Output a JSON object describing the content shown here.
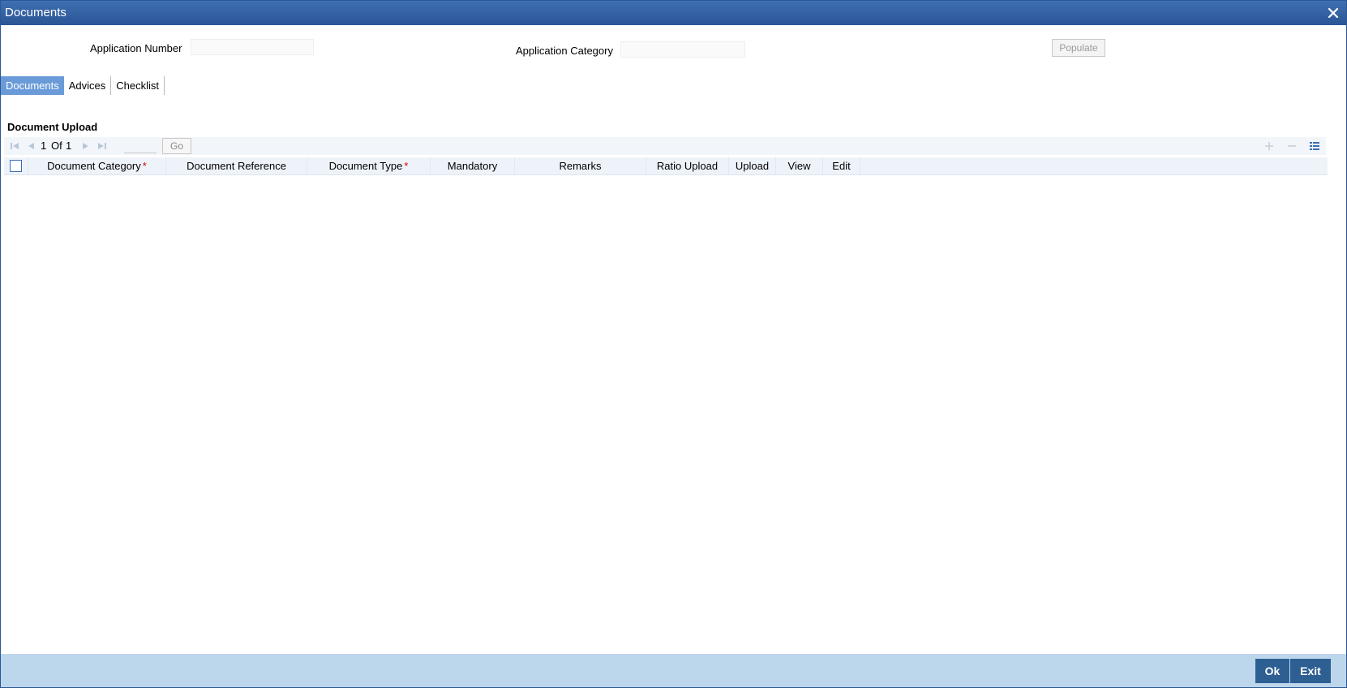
{
  "window": {
    "title": "Documents",
    "close_icon": "close-icon"
  },
  "header_fields": {
    "application_number_label": "Application Number",
    "application_number_value": "",
    "application_category_label": "Application Category",
    "application_category_value": "",
    "populate_label": "Populate"
  },
  "tabs": [
    {
      "label": "Documents",
      "active": true
    },
    {
      "label": "Advices",
      "active": false
    },
    {
      "label": "Checklist",
      "active": false
    }
  ],
  "document_upload": {
    "title": "Document Upload",
    "pagination": {
      "current": "1",
      "of_label": "Of",
      "total": "1",
      "page_input": "",
      "go_label": "Go"
    },
    "columns": [
      {
        "label": "Document Category",
        "required": true
      },
      {
        "label": "Document Reference",
        "required": false
      },
      {
        "label": "Document Type",
        "required": true
      },
      {
        "label": "Mandatory",
        "required": false
      },
      {
        "label": "Remarks",
        "required": false
      },
      {
        "label": "Ratio Upload",
        "required": false
      },
      {
        "label": "Upload",
        "required": false
      },
      {
        "label": "View",
        "required": false
      },
      {
        "label": "Edit",
        "required": false
      }
    ],
    "required_marker": "*",
    "rows": []
  },
  "footer": {
    "ok_label": "Ok",
    "exit_label": "Exit"
  },
  "colors": {
    "title_bar": "#2a5596",
    "active_tab": "#6a9bd8",
    "footer_bar": "#bcd6ec",
    "footer_button": "#2d5f93",
    "required": "#dd0000"
  }
}
